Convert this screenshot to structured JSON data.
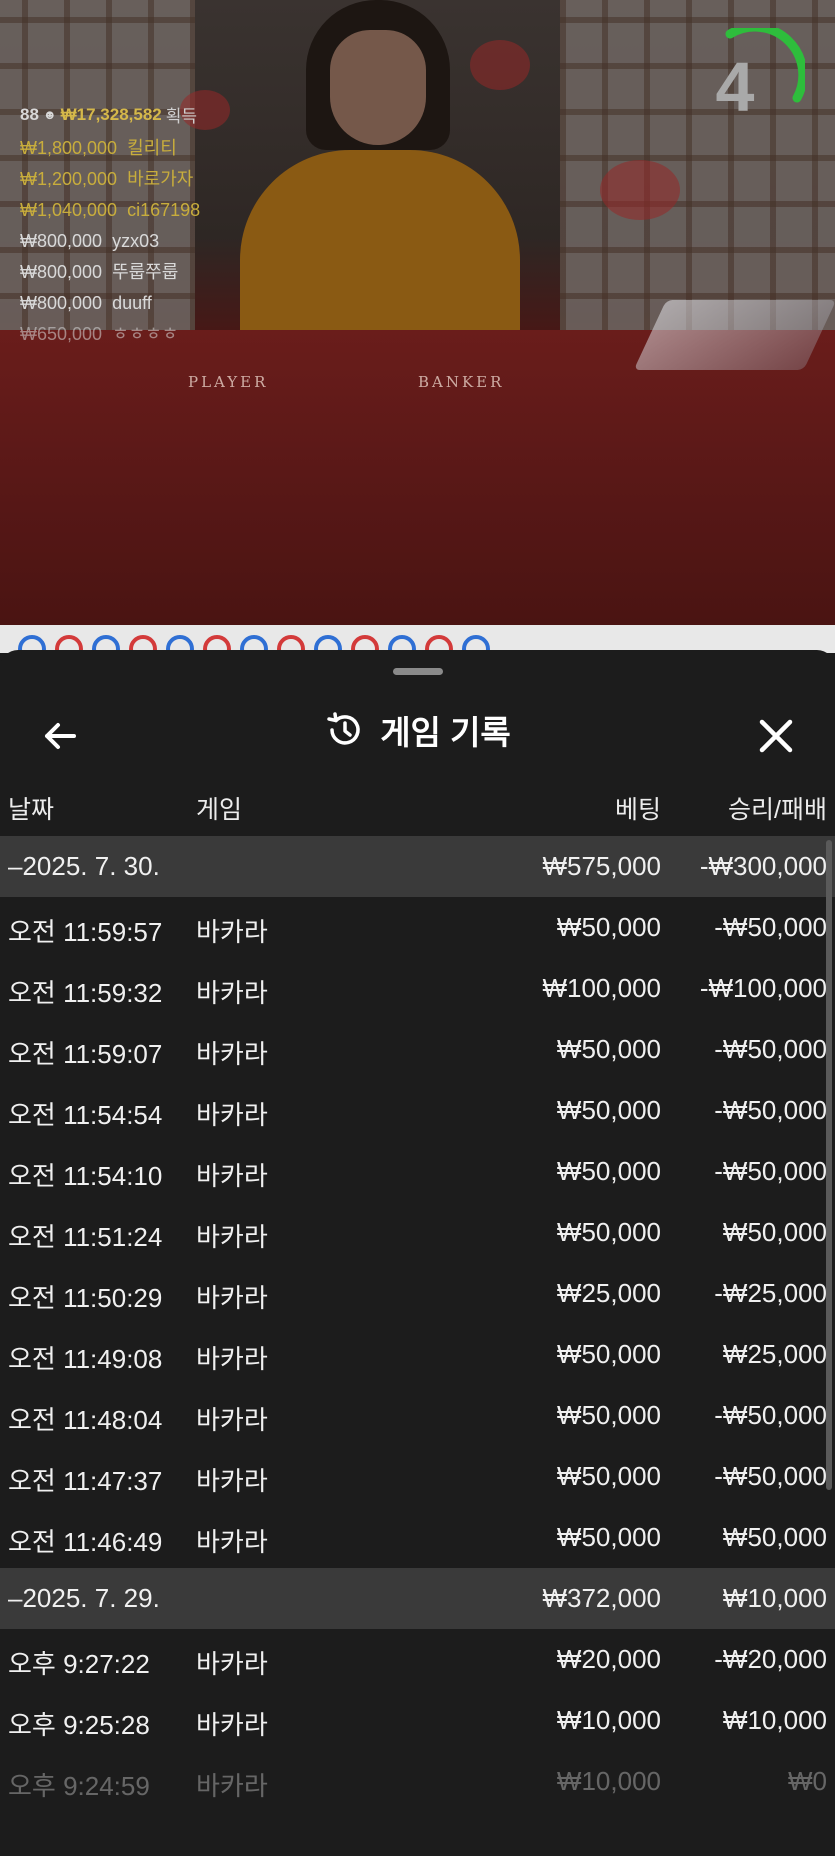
{
  "video": {
    "timer_value": "4",
    "table_labels": [
      "PLAYER",
      "BANKER"
    ],
    "winners_header": {
      "count": "88",
      "total": "₩17,328,582",
      "label": "획득"
    },
    "winners": [
      {
        "amount": "₩1,800,000",
        "name": "킬리티"
      },
      {
        "amount": "₩1,200,000",
        "name": "바로가자"
      },
      {
        "amount": "₩1,040,000",
        "name": "ci167198"
      },
      {
        "amount": "₩800,000",
        "name": "yzx03"
      },
      {
        "amount": "₩800,000",
        "name": "뚜룹쭈룹"
      },
      {
        "amount": "₩800,000",
        "name": "duuff"
      },
      {
        "amount": "₩650,000",
        "name": "ㅎㅎㅎㅎ"
      }
    ],
    "colors": {
      "gold": "#c8ad3c",
      "timer_green": "#2ebd3c",
      "player_blue": "#2f6fd4",
      "banker_red": "#d33a3a"
    }
  },
  "sheet": {
    "title": "게임 기록",
    "back_icon": "arrow-left-icon",
    "history_icon": "history-clock-icon",
    "close_icon": "close-x-icon",
    "columns": {
      "date": "날짜",
      "game": "게임",
      "bet": "베팅",
      "result": "승리/패배"
    },
    "groups": [
      {
        "date": "–2025. 7. 30.",
        "bet_total": "₩575,000",
        "result_total": "-₩300,000",
        "rows": [
          {
            "time": "오전 11:59:57",
            "game": "바카라",
            "bet": "₩50,000",
            "result": "-₩50,000"
          },
          {
            "time": "오전 11:59:32",
            "game": "바카라",
            "bet": "₩100,000",
            "result": "-₩100,000"
          },
          {
            "time": "오전 11:59:07",
            "game": "바카라",
            "bet": "₩50,000",
            "result": "-₩50,000"
          },
          {
            "time": "오전 11:54:54",
            "game": "바카라",
            "bet": "₩50,000",
            "result": "-₩50,000"
          },
          {
            "time": "오전 11:54:10",
            "game": "바카라",
            "bet": "₩50,000",
            "result": "-₩50,000"
          },
          {
            "time": "오전 11:51:24",
            "game": "바카라",
            "bet": "₩50,000",
            "result": "₩50,000"
          },
          {
            "time": "오전 11:50:29",
            "game": "바카라",
            "bet": "₩25,000",
            "result": "-₩25,000"
          },
          {
            "time": "오전 11:49:08",
            "game": "바카라",
            "bet": "₩50,000",
            "result": "₩25,000"
          },
          {
            "time": "오전 11:48:04",
            "game": "바카라",
            "bet": "₩50,000",
            "result": "-₩50,000"
          },
          {
            "time": "오전 11:47:37",
            "game": "바카라",
            "bet": "₩50,000",
            "result": "-₩50,000"
          },
          {
            "time": "오전 11:46:49",
            "game": "바카라",
            "bet": "₩50,000",
            "result": "₩50,000"
          }
        ]
      },
      {
        "date": "–2025. 7. 29.",
        "bet_total": "₩372,000",
        "result_total": "₩10,000",
        "rows": [
          {
            "time": "오후 9:27:22",
            "game": "바카라",
            "bet": "₩20,000",
            "result": "-₩20,000"
          },
          {
            "time": "오후 9:25:28",
            "game": "바카라",
            "bet": "₩10,000",
            "result": "₩10,000"
          },
          {
            "time": "오후 9:24:59",
            "game": "바카라",
            "bet": "₩10,000",
            "result": "₩0"
          }
        ]
      }
    ]
  }
}
